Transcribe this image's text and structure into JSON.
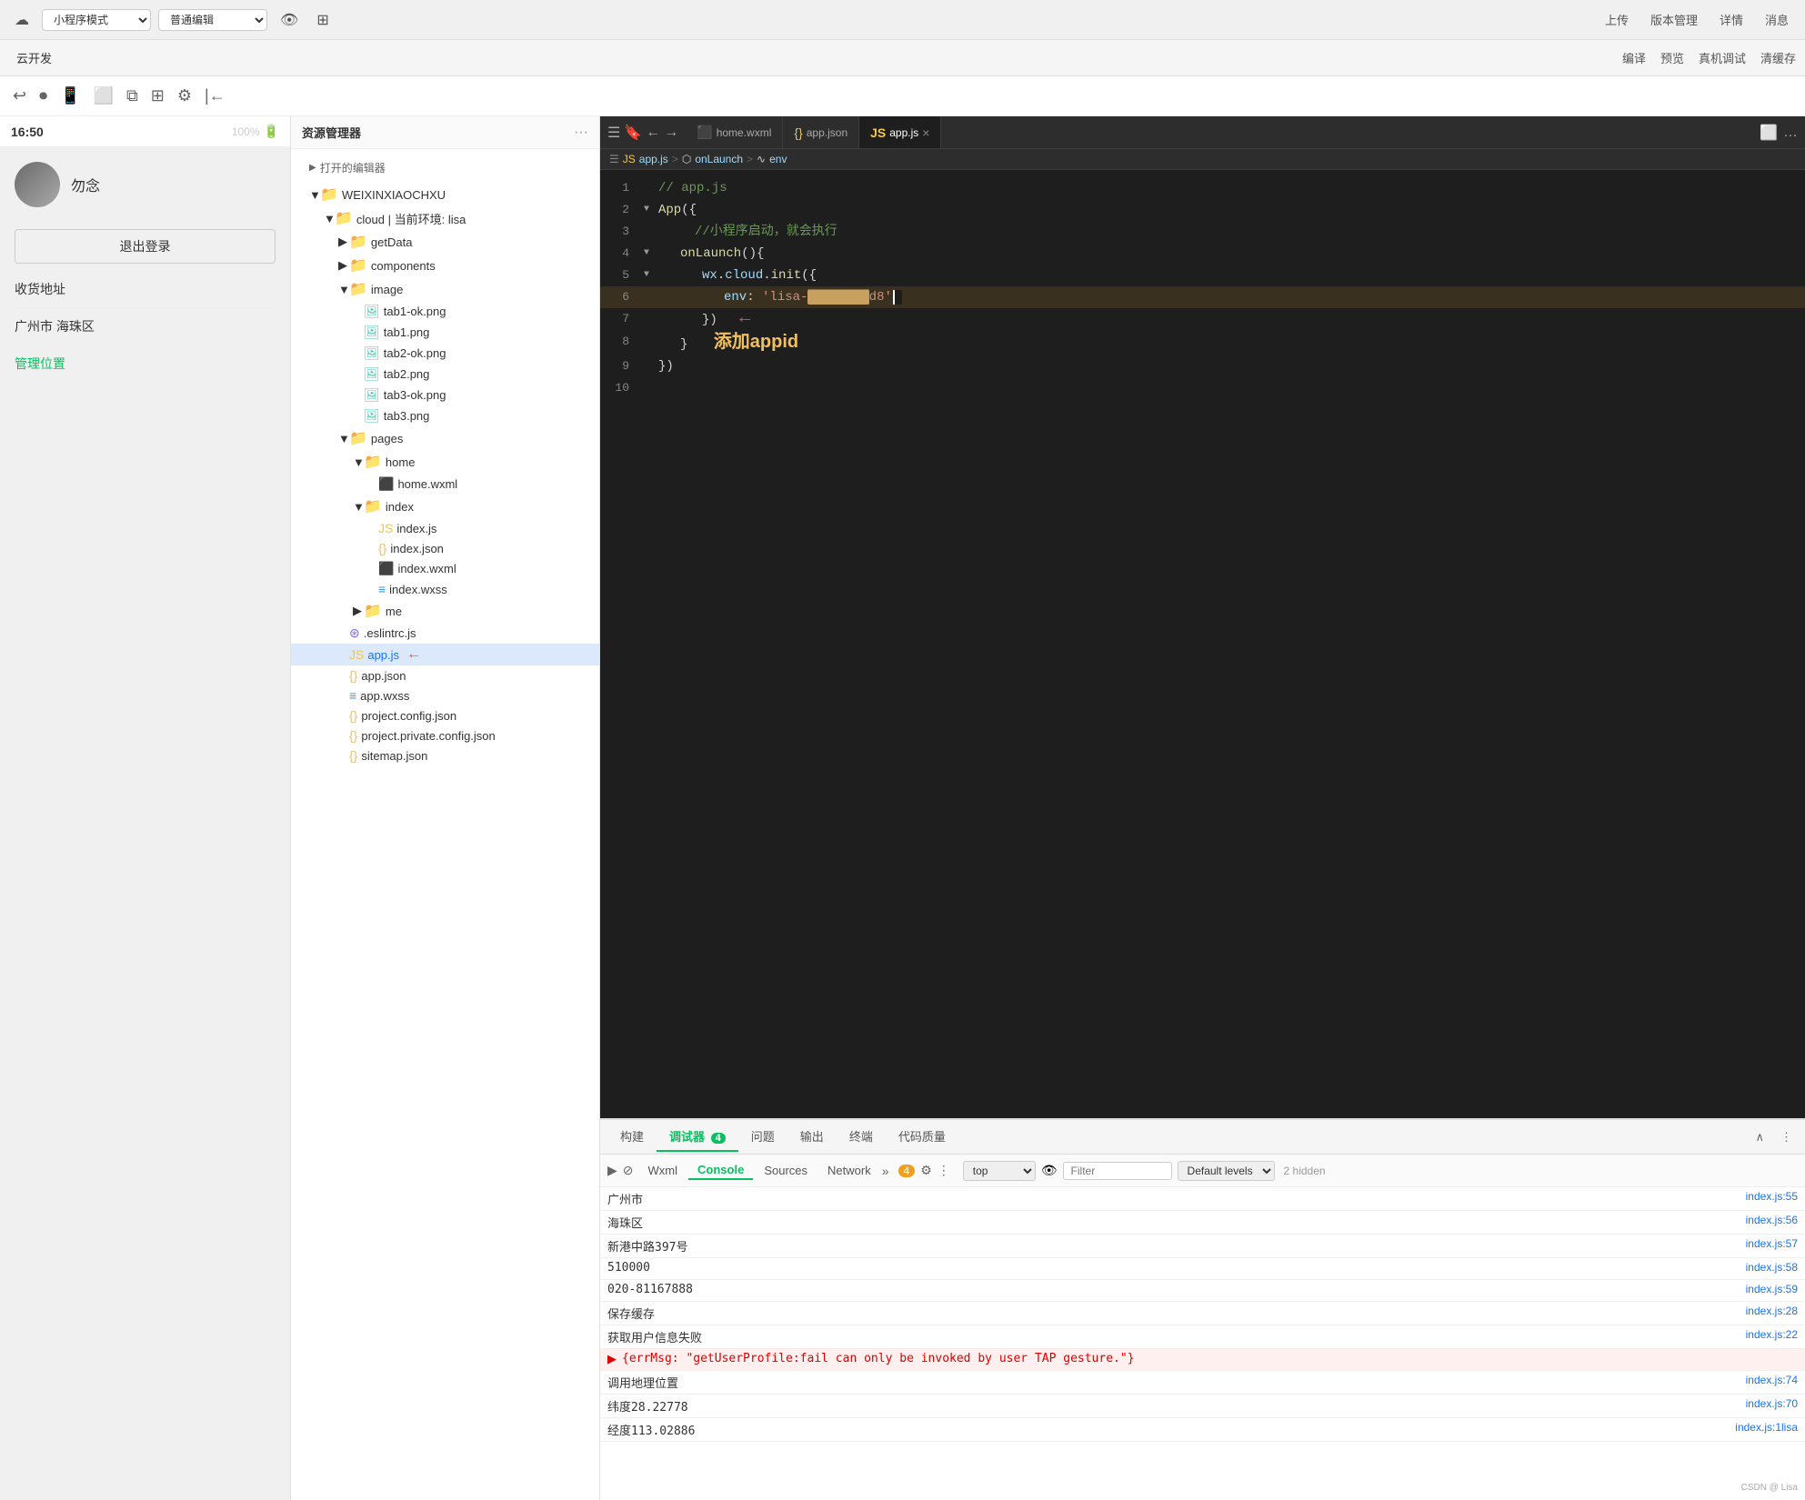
{
  "topToolbar": {
    "btnMiniProgram": "小程序模式",
    "btnEditor": "普通编辑",
    "icons": [
      "↩",
      "⏺",
      "□",
      "□",
      "□",
      "□",
      "⊕",
      "☁"
    ],
    "rightBtns": [
      "上传",
      "版本管理",
      "详情",
      "消息"
    ]
  },
  "secondToolbar": {
    "cloudDev": "云开发",
    "rightItems": [
      "编译",
      "预览",
      "真机调试",
      "清缓存"
    ]
  },
  "filePanel": {
    "title": "资源管理器",
    "more": "···",
    "openEditor": "打开的编辑器",
    "rootName": "WEIXINXIAOCHXU",
    "tree": [
      {
        "id": "cloud",
        "name": "cloud | 当前环境: lisa",
        "indent": 1,
        "type": "folder",
        "expanded": true
      },
      {
        "id": "getData",
        "name": "getData",
        "indent": 2,
        "type": "folder"
      },
      {
        "id": "components",
        "name": "components",
        "indent": 2,
        "type": "folder"
      },
      {
        "id": "image",
        "name": "image",
        "indent": 2,
        "type": "folder",
        "expanded": true
      },
      {
        "id": "tab1-ok",
        "name": "tab1-ok.png",
        "indent": 3,
        "type": "img"
      },
      {
        "id": "tab1",
        "name": "tab1.png",
        "indent": 3,
        "type": "img"
      },
      {
        "id": "tab2-ok",
        "name": "tab2-ok.png",
        "indent": 3,
        "type": "img"
      },
      {
        "id": "tab2",
        "name": "tab2.png",
        "indent": 3,
        "type": "img"
      },
      {
        "id": "tab3-ok",
        "name": "tab3-ok.png",
        "indent": 3,
        "type": "img"
      },
      {
        "id": "tab3",
        "name": "tab3.png",
        "indent": 3,
        "type": "img"
      },
      {
        "id": "pages",
        "name": "pages",
        "indent": 2,
        "type": "folder",
        "expanded": true
      },
      {
        "id": "home",
        "name": "home",
        "indent": 3,
        "type": "folder",
        "expanded": true
      },
      {
        "id": "home-wxml",
        "name": "home.wxml",
        "indent": 4,
        "type": "wxml"
      },
      {
        "id": "index-folder",
        "name": "index",
        "indent": 3,
        "type": "folder",
        "expanded": true
      },
      {
        "id": "index-js",
        "name": "index.js",
        "indent": 4,
        "type": "js"
      },
      {
        "id": "index-json",
        "name": "index.json",
        "indent": 4,
        "type": "json"
      },
      {
        "id": "index-wxml",
        "name": "index.wxml",
        "indent": 4,
        "type": "wxml"
      },
      {
        "id": "index-wxss",
        "name": "index.wxss",
        "indent": 4,
        "type": "wxss"
      },
      {
        "id": "me-folder",
        "name": "me",
        "indent": 3,
        "type": "folder"
      },
      {
        "id": "eslintrc",
        "name": ".eslintrc.js",
        "indent": 2,
        "type": "eslint"
      },
      {
        "id": "app-js",
        "name": "app.js",
        "indent": 2,
        "type": "js",
        "selected": true
      },
      {
        "id": "app-json",
        "name": "app.json",
        "indent": 2,
        "type": "json"
      },
      {
        "id": "app-wxss",
        "name": "app.wxss",
        "indent": 2,
        "type": "wxss"
      },
      {
        "id": "project-config",
        "name": "project.config.json",
        "indent": 2,
        "type": "json"
      },
      {
        "id": "project-private",
        "name": "project.private.config.json",
        "indent": 2,
        "type": "json"
      },
      {
        "id": "sitemap",
        "name": "sitemap.json",
        "indent": 2,
        "type": "json"
      }
    ]
  },
  "editor": {
    "tabs": [
      {
        "id": "home-wxml",
        "label": "home.wxml",
        "icon": "wxml",
        "active": false
      },
      {
        "id": "app-json",
        "label": "app.json",
        "icon": "json",
        "active": false
      },
      {
        "id": "app-js",
        "label": "app.js",
        "icon": "js",
        "active": true,
        "closable": true
      }
    ],
    "breadcrumb": [
      "app.js",
      "onLaunch",
      "env"
    ],
    "lines": [
      {
        "num": 1,
        "content": "// app.js",
        "type": "comment"
      },
      {
        "num": 2,
        "content": "App({",
        "type": "code",
        "arrow": true
      },
      {
        "num": 3,
        "content": "    //小程序启动，就会执行",
        "type": "comment-indent"
      },
      {
        "num": 4,
        "content": "    onLaunch(){",
        "type": "code",
        "arrow": true
      },
      {
        "num": 5,
        "content": "        wx.cloud.init({",
        "type": "code",
        "arrow": true
      },
      {
        "num": 6,
        "content": "            env: 'lisa-████████d8'",
        "type": "code-env",
        "arrow": false
      },
      {
        "num": 7,
        "content": "        })",
        "type": "code"
      },
      {
        "num": 8,
        "content": "    }",
        "type": "code",
        "annotation": "添加appid"
      },
      {
        "num": 9,
        "content": "})",
        "type": "code"
      },
      {
        "num": 10,
        "content": "",
        "type": "empty"
      }
    ]
  },
  "bottomPanel": {
    "tabs": [
      {
        "id": "build",
        "label": "构建",
        "count": null
      },
      {
        "id": "console",
        "label": "调试器",
        "count": "4",
        "active": true
      },
      {
        "id": "issues",
        "label": "问题",
        "count": null
      },
      {
        "id": "output",
        "label": "输出",
        "count": null
      },
      {
        "id": "terminal",
        "label": "终端",
        "count": null
      },
      {
        "id": "quality",
        "label": "代码质量",
        "count": null
      }
    ],
    "consoleTabs": [
      "Wxml",
      "Console",
      "Sources",
      "Network"
    ],
    "activeConsoleTab": "Console",
    "topSelector": "top",
    "filterPlaceholder": "Filter",
    "levelLabel": "Default levels",
    "hiddenCount": "2 hidden",
    "warningCount": "4",
    "rows": [
      {
        "msg": "广州市",
        "link": "index.js:55",
        "type": "normal"
      },
      {
        "msg": "海珠区",
        "link": "index.js:56",
        "type": "normal"
      },
      {
        "msg": "新港中路397号",
        "link": "index.js:57",
        "type": "normal"
      },
      {
        "msg": "510000",
        "link": "index.js:58",
        "type": "normal"
      },
      {
        "msg": "020-81167888",
        "link": "index.js:59",
        "type": "normal"
      },
      {
        "msg": "保存缓存",
        "link": "index.js:28",
        "type": "normal"
      },
      {
        "msg": "获取用户信息失败",
        "link": "index.js:22",
        "type": "normal"
      },
      {
        "msg": "{errMsg: \"getUserProfile:fail can only be invoked by user TAP gesture.\"}",
        "link": "",
        "type": "error-detail"
      },
      {
        "msg": "调用地理位置",
        "link": "index.js:74",
        "type": "normal"
      },
      {
        "msg": "纬度28.22778",
        "link": "index.js:70",
        "type": "normal"
      },
      {
        "msg": "经度113.02886",
        "link": "index.js:1lisa",
        "type": "normal"
      }
    ]
  },
  "phone": {
    "time": "16:50",
    "battery": "100%",
    "username": "勿念",
    "logoutText": "退出登录",
    "addressTitle": "收货地址",
    "manageText": "管理位置"
  }
}
